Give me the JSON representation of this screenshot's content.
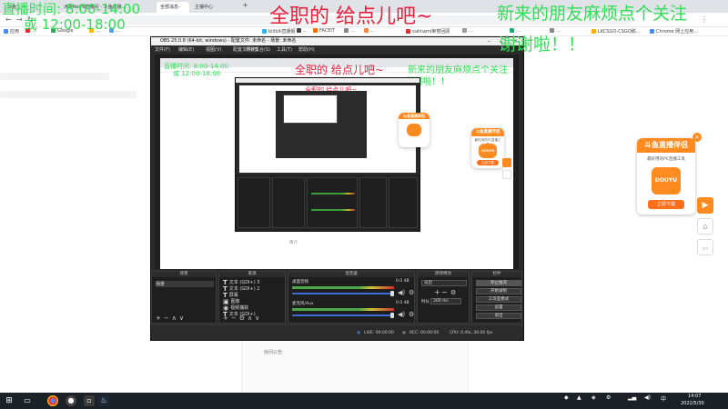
{
  "browser": {
    "tabs": [
      {
        "label": "斗鱼…",
        "active": false
      },
      {
        "label": "大屋RelPo直播间 - 斗鱼直播…",
        "active": false
      },
      {
        "label": "全部消息-",
        "active": true
      },
      {
        "label": "主播中心",
        "active": false
      }
    ],
    "bookmarks": [
      "应用",
      "…",
      "Google",
      "…",
      "…",
      "bilibili直播姬",
      "…",
      "FACEIT",
      "…",
      "…",
      "valinami荣誉回顾",
      "…",
      "…",
      "…",
      "LKCSGO-CSGO稿…",
      "Chrome 网上应用…"
    ]
  },
  "overlay": {
    "live_time": "直播时间: 8:00-14:00",
    "live_time2": "或 12:00-18:00",
    "red_title": "全职的 给点儿吧~",
    "green_line1": "新来的朋友麻烦点个关注",
    "green_line2": "谢谢啦！！"
  },
  "obs": {
    "title": "OBS 25.0.8 (64-bit, windows) - 配置文件: 未命名 - 场景: 未命名",
    "menu": [
      "文件(F)",
      "编辑(E)",
      "视图(V)",
      "配置文件(P)",
      "场景集合(S)",
      "工具(T)",
      "帮助(H)"
    ],
    "preview_inner": {
      "overlay_time": "直播时间: 8:00-14:00",
      "overlay_time2": "或 12:00-18:00",
      "red_title": "全职的 给点儿吧~",
      "green_line1": "新来的朋友麻烦点个关注",
      "green_line2": "谢谢啦！！",
      "nested_red": "全职的 给点儿吧~",
      "page_footer": "简介"
    },
    "docks": {
      "scenes": {
        "title": "场景",
        "items": [
          "场景"
        ]
      },
      "sources": {
        "title": "来源",
        "items": [
          {
            "icon": "T",
            "label": "文本 (GDI+) 3"
          },
          {
            "icon": "T",
            "label": "文本 (GDI+) 2"
          },
          {
            "icon": "T",
            "label": "屏幕"
          },
          {
            "icon": "▣",
            "label": "图像"
          },
          {
            "icon": "◉",
            "label": "视频捕获"
          },
          {
            "icon": "T",
            "label": "文本 (GDI+)"
          }
        ]
      },
      "mixer": {
        "title": "混音器",
        "channels": [
          {
            "name": "桌面音频",
            "db": "0.0 dB"
          },
          {
            "name": "麦克风/Aux",
            "db": "0.0 dB"
          }
        ]
      },
      "transitions": {
        "title": "转场特效",
        "type": "淡出",
        "duration_label": "时长",
        "duration": "300 ms"
      },
      "controls": {
        "title": "控件",
        "buttons": [
          "停止推流",
          "开始录制",
          "工作室模式",
          "设置",
          "退出"
        ]
      }
    },
    "status": {
      "live": "LIVE: 00:00:00",
      "rec": "REC: 00:00:00",
      "cpu": "CPU: 0.4%, 30.00 fps"
    }
  },
  "page": {
    "footer_label": "房间公告:"
  },
  "douyu": {
    "card_title": "斗鱼直播伴侣",
    "card_desc": "最好用的PC直播工具",
    "logo_text": "DOUYU",
    "download": "立即下载",
    "small_title": "斗鱼直播伴侣",
    "small_desc": "最好用的PC直播工具",
    "small_download": "立即下载"
  },
  "taskbar": {
    "time": "14:07",
    "date": "2022/5/30",
    "lang": "中"
  },
  "colors": {
    "overlay_green": "#33dd55",
    "overlay_red": "#e8203c",
    "douyu_orange": "#ff8a1f",
    "obs_dark": "#2b2b2b"
  }
}
